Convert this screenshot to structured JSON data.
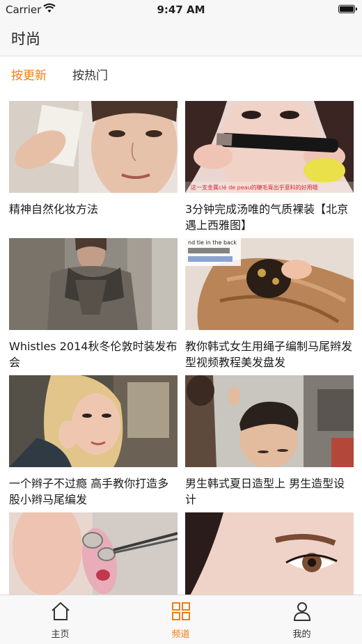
{
  "status_bar": {
    "carrier": "Carrier",
    "time": "9:47 AM",
    "wifi_icon": "wifi-icon",
    "battery_icon": "battery-icon"
  },
  "nav": {
    "title": "时尚"
  },
  "tabs": [
    {
      "label": "按更新",
      "active": true
    },
    {
      "label": "按热门",
      "active": false
    }
  ],
  "videos": [
    {
      "title": "精神自然化妆方法",
      "thumb_overlay": ""
    },
    {
      "title": "3分钟完成汤唯的气质裸装【北京遇上西雅图】",
      "thumb_overlay": "这一支金属clé de peau的睫毛膏出乎意料的好用哦"
    },
    {
      "title": "Whistles 2014秋冬伦敦时装发布会",
      "thumb_overlay": ""
    },
    {
      "title": "教你韩式女生用绳子编制马尾辫发型视频教程美发盘发",
      "thumb_overlay": "nd tie in the back"
    },
    {
      "title": "一个辫子不过瘾 高手教你打造多股小辫马尾编发",
      "thumb_overlay": ""
    },
    {
      "title": "男生韩式夏日造型上 男生造型设计",
      "thumb_overlay": ""
    },
    {
      "title": "",
      "thumb_overlay": ""
    },
    {
      "title": "",
      "thumb_overlay": ""
    }
  ],
  "tabbar": [
    {
      "label": "主页",
      "icon": "home-icon",
      "active": false
    },
    {
      "label": "频道",
      "icon": "grid-icon",
      "active": true
    },
    {
      "label": "我的",
      "icon": "person-icon",
      "active": false
    }
  ],
  "colors": {
    "accent": "#f07e12",
    "bar_bg": "#f7f7f7"
  }
}
